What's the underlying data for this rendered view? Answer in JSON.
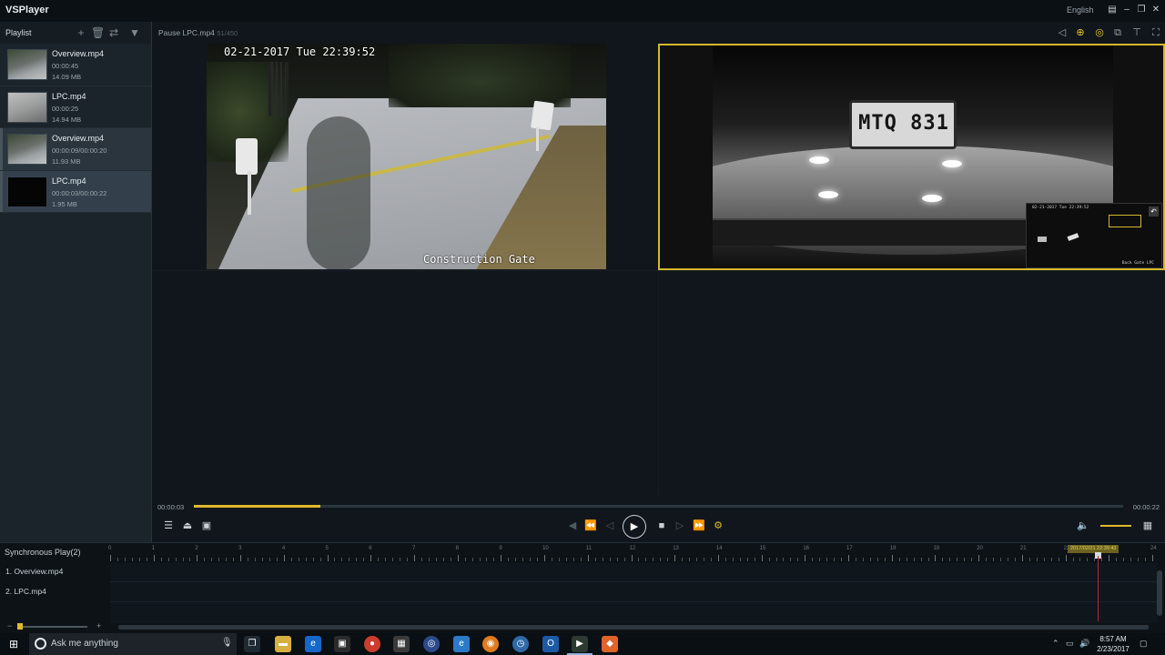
{
  "window": {
    "title": "VSPlayer",
    "language": "English",
    "buttons": [
      "menu-icon",
      "minimize-icon",
      "restore-icon",
      "close-icon"
    ]
  },
  "playlist": {
    "title": "Playlist",
    "items": [
      {
        "name": "Overview.mp4",
        "duration": "00:00:45",
        "size": "14.09 MB",
        "thumb": "road"
      },
      {
        "name": "LPC.mp4",
        "duration": "00:00:25",
        "size": "14.94 MB",
        "thumb": "road2"
      },
      {
        "name": "Overview.mp4",
        "duration": "00:00:09/00:00:20",
        "size": "11.93 MB",
        "thumb": "road"
      },
      {
        "name": "LPC.mp4",
        "duration": "00:00:03/00:00:22",
        "size": "1.95 MB",
        "thumb": "dark"
      }
    ]
  },
  "video_toolbar": {
    "status": "Pause LPC.mp4",
    "frames": "51/450"
  },
  "video1": {
    "timestamp": "02-21-2017 Tue 22:39:52",
    "camera": "Construction Gate"
  },
  "video2": {
    "plate": "MTQ 831",
    "mini_timestamp": "02-21-2017 Tue 22:39:52",
    "mini_label": "Back Gate LPC"
  },
  "playback": {
    "current_time": "00:00:03",
    "total_time": "00:00:22",
    "progress": 0.136,
    "volume": 1.0
  },
  "sync": {
    "title": "Synchronous Play(2)",
    "rows": [
      "1.  Overview.mp4",
      "2.  LPC.mp4"
    ],
    "ruler_labels": [
      "0",
      "1",
      "2",
      "3",
      "4",
      "5",
      "6",
      "7",
      "8",
      "9",
      "10",
      "11",
      "12",
      "13",
      "14",
      "15",
      "16",
      "17",
      "18",
      "19",
      "20",
      "21",
      "22",
      "23",
      "24"
    ],
    "cursor_label": "2017/02/21 22:39:43"
  },
  "taskbar": {
    "search_placeholder": "Ask me anything",
    "time": "8:57 AM",
    "date": "2/23/2017"
  },
  "colors": {
    "accent": "#e0b92a",
    "selection_border": "#d4b92c",
    "cursor": "#b52a2a"
  }
}
